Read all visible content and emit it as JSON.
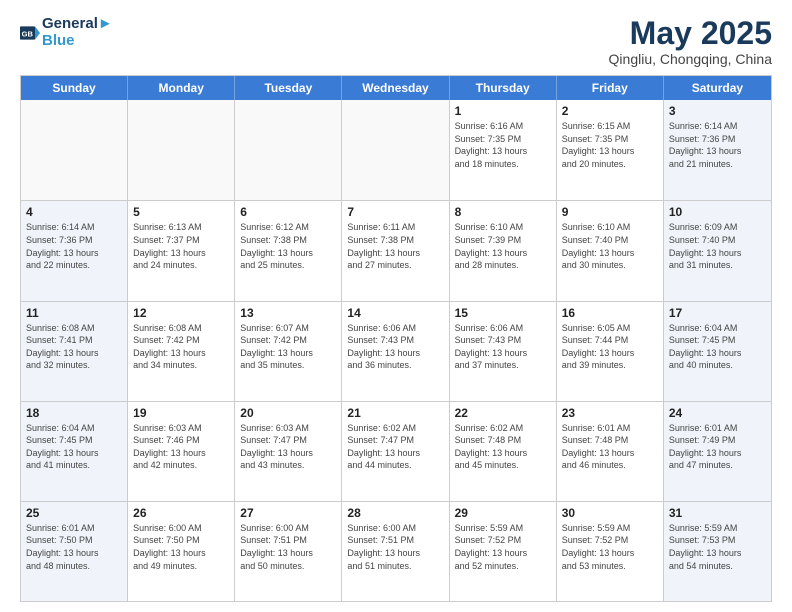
{
  "logo": {
    "line1": "General",
    "line2": "Blue"
  },
  "title": "May 2025",
  "subtitle": "Qingliu, Chongqing, China",
  "headers": [
    "Sunday",
    "Monday",
    "Tuesday",
    "Wednesday",
    "Thursday",
    "Friday",
    "Saturday"
  ],
  "weeks": [
    [
      {
        "day": "",
        "info": ""
      },
      {
        "day": "",
        "info": ""
      },
      {
        "day": "",
        "info": ""
      },
      {
        "day": "",
        "info": ""
      },
      {
        "day": "1",
        "info": "Sunrise: 6:16 AM\nSunset: 7:35 PM\nDaylight: 13 hours\nand 18 minutes."
      },
      {
        "day": "2",
        "info": "Sunrise: 6:15 AM\nSunset: 7:35 PM\nDaylight: 13 hours\nand 20 minutes."
      },
      {
        "day": "3",
        "info": "Sunrise: 6:14 AM\nSunset: 7:36 PM\nDaylight: 13 hours\nand 21 minutes."
      }
    ],
    [
      {
        "day": "4",
        "info": "Sunrise: 6:14 AM\nSunset: 7:36 PM\nDaylight: 13 hours\nand 22 minutes."
      },
      {
        "day": "5",
        "info": "Sunrise: 6:13 AM\nSunset: 7:37 PM\nDaylight: 13 hours\nand 24 minutes."
      },
      {
        "day": "6",
        "info": "Sunrise: 6:12 AM\nSunset: 7:38 PM\nDaylight: 13 hours\nand 25 minutes."
      },
      {
        "day": "7",
        "info": "Sunrise: 6:11 AM\nSunset: 7:38 PM\nDaylight: 13 hours\nand 27 minutes."
      },
      {
        "day": "8",
        "info": "Sunrise: 6:10 AM\nSunset: 7:39 PM\nDaylight: 13 hours\nand 28 minutes."
      },
      {
        "day": "9",
        "info": "Sunrise: 6:10 AM\nSunset: 7:40 PM\nDaylight: 13 hours\nand 30 minutes."
      },
      {
        "day": "10",
        "info": "Sunrise: 6:09 AM\nSunset: 7:40 PM\nDaylight: 13 hours\nand 31 minutes."
      }
    ],
    [
      {
        "day": "11",
        "info": "Sunrise: 6:08 AM\nSunset: 7:41 PM\nDaylight: 13 hours\nand 32 minutes."
      },
      {
        "day": "12",
        "info": "Sunrise: 6:08 AM\nSunset: 7:42 PM\nDaylight: 13 hours\nand 34 minutes."
      },
      {
        "day": "13",
        "info": "Sunrise: 6:07 AM\nSunset: 7:42 PM\nDaylight: 13 hours\nand 35 minutes."
      },
      {
        "day": "14",
        "info": "Sunrise: 6:06 AM\nSunset: 7:43 PM\nDaylight: 13 hours\nand 36 minutes."
      },
      {
        "day": "15",
        "info": "Sunrise: 6:06 AM\nSunset: 7:43 PM\nDaylight: 13 hours\nand 37 minutes."
      },
      {
        "day": "16",
        "info": "Sunrise: 6:05 AM\nSunset: 7:44 PM\nDaylight: 13 hours\nand 39 minutes."
      },
      {
        "day": "17",
        "info": "Sunrise: 6:04 AM\nSunset: 7:45 PM\nDaylight: 13 hours\nand 40 minutes."
      }
    ],
    [
      {
        "day": "18",
        "info": "Sunrise: 6:04 AM\nSunset: 7:45 PM\nDaylight: 13 hours\nand 41 minutes."
      },
      {
        "day": "19",
        "info": "Sunrise: 6:03 AM\nSunset: 7:46 PM\nDaylight: 13 hours\nand 42 minutes."
      },
      {
        "day": "20",
        "info": "Sunrise: 6:03 AM\nSunset: 7:47 PM\nDaylight: 13 hours\nand 43 minutes."
      },
      {
        "day": "21",
        "info": "Sunrise: 6:02 AM\nSunset: 7:47 PM\nDaylight: 13 hours\nand 44 minutes."
      },
      {
        "day": "22",
        "info": "Sunrise: 6:02 AM\nSunset: 7:48 PM\nDaylight: 13 hours\nand 45 minutes."
      },
      {
        "day": "23",
        "info": "Sunrise: 6:01 AM\nSunset: 7:48 PM\nDaylight: 13 hours\nand 46 minutes."
      },
      {
        "day": "24",
        "info": "Sunrise: 6:01 AM\nSunset: 7:49 PM\nDaylight: 13 hours\nand 47 minutes."
      }
    ],
    [
      {
        "day": "25",
        "info": "Sunrise: 6:01 AM\nSunset: 7:50 PM\nDaylight: 13 hours\nand 48 minutes."
      },
      {
        "day": "26",
        "info": "Sunrise: 6:00 AM\nSunset: 7:50 PM\nDaylight: 13 hours\nand 49 minutes."
      },
      {
        "day": "27",
        "info": "Sunrise: 6:00 AM\nSunset: 7:51 PM\nDaylight: 13 hours\nand 50 minutes."
      },
      {
        "day": "28",
        "info": "Sunrise: 6:00 AM\nSunset: 7:51 PM\nDaylight: 13 hours\nand 51 minutes."
      },
      {
        "day": "29",
        "info": "Sunrise: 5:59 AM\nSunset: 7:52 PM\nDaylight: 13 hours\nand 52 minutes."
      },
      {
        "day": "30",
        "info": "Sunrise: 5:59 AM\nSunset: 7:52 PM\nDaylight: 13 hours\nand 53 minutes."
      },
      {
        "day": "31",
        "info": "Sunrise: 5:59 AM\nSunset: 7:53 PM\nDaylight: 13 hours\nand 54 minutes."
      }
    ]
  ]
}
